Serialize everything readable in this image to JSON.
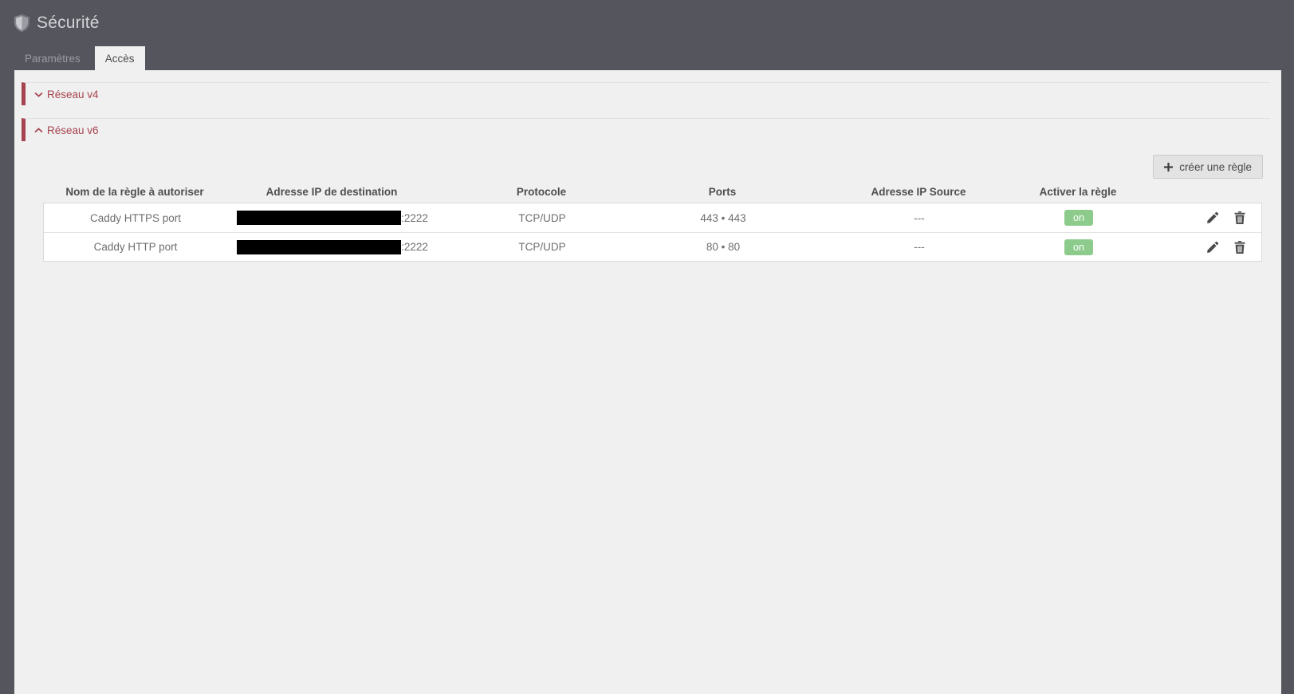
{
  "header": {
    "title": "Sécurité",
    "icon": "shield-icon"
  },
  "tabs": [
    {
      "label": "Paramètres",
      "active": false
    },
    {
      "label": "Accès",
      "active": true
    }
  ],
  "sections": [
    {
      "label": "Réseau v4",
      "expanded": false
    },
    {
      "label": "Réseau v6",
      "expanded": true
    }
  ],
  "toolbar": {
    "create_rule_label": "créer une règle",
    "create_rule_icon": "plus-icon"
  },
  "table": {
    "columns": [
      "Nom de la règle à autoriser",
      "Adresse IP de destination",
      "Protocole",
      "Ports",
      "Adresse IP Source",
      "Activer la règle"
    ],
    "rows": [
      {
        "name": "Caddy HTTPS port",
        "destination_redacted": true,
        "destination_suffix": ":2222",
        "protocol": "TCP/UDP",
        "ports": "443 • 443",
        "source": "---",
        "enabled_label": "on"
      },
      {
        "name": "Caddy HTTP port",
        "destination_redacted": true,
        "destination_suffix": ":2222",
        "protocol": "TCP/UDP",
        "ports": "80 • 80",
        "source": "---",
        "enabled_label": "on"
      }
    ],
    "row_action_icons": [
      "pencil-icon",
      "trash-icon"
    ]
  },
  "colors": {
    "chrome_background": "#55555e",
    "panel_background": "#f0f0f0",
    "accent_red": "#a6434e",
    "badge_green": "#8ccb8c",
    "row_background": "#ffffff"
  }
}
